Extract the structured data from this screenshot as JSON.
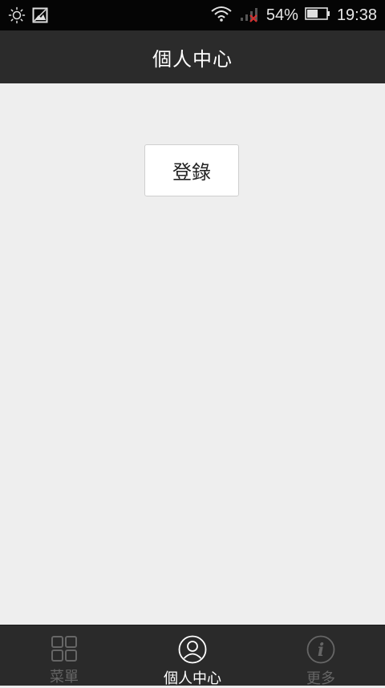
{
  "status_bar": {
    "battery": "54%",
    "time": "19:38",
    "icons": [
      "brightness-icon",
      "image-icon",
      "wifi-icon",
      "signal-icon",
      "battery-icon"
    ]
  },
  "header": {
    "title": "個人中心"
  },
  "main": {
    "login_label": "登錄"
  },
  "bottom_nav": {
    "items": [
      {
        "label": "菜單",
        "icon": "grid-icon",
        "active": false
      },
      {
        "label": "個人中心",
        "icon": "user-icon",
        "active": true
      },
      {
        "label": "更多",
        "icon": "info-icon",
        "active": false
      }
    ]
  },
  "colors": {
    "status_bar_bg": "#050505",
    "title_bar_bg": "#2b2b2b",
    "content_bg": "#eeeeee",
    "nav_bg": "#2a2a2a",
    "nav_inactive": "#666666",
    "nav_active": "#ffffff",
    "signal_alert": "#d32f2f"
  }
}
